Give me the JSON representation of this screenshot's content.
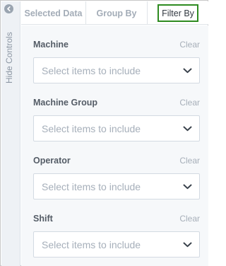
{
  "side_panel": {
    "collapse_icon": "chevron-left-icon",
    "hide_label": "Hide Controls"
  },
  "tabs": [
    {
      "label": "Selected Data"
    },
    {
      "label": "Group By"
    },
    {
      "label": "Filter By",
      "active": true
    }
  ],
  "filters": [
    {
      "title": "Machine",
      "clear_label": "Clear",
      "placeholder": "Select items to include"
    },
    {
      "title": "Machine Group",
      "clear_label": "Clear",
      "placeholder": "Select items to include"
    },
    {
      "title": "Operator",
      "clear_label": "Clear",
      "placeholder": "Select items to include"
    },
    {
      "title": "Shift",
      "clear_label": "Clear",
      "placeholder": "Select items to include"
    }
  ],
  "colors": {
    "active_tab_outline": "#2e8b20",
    "panel_background": "#f6f8fa",
    "rail_background": "#eef1f5"
  }
}
